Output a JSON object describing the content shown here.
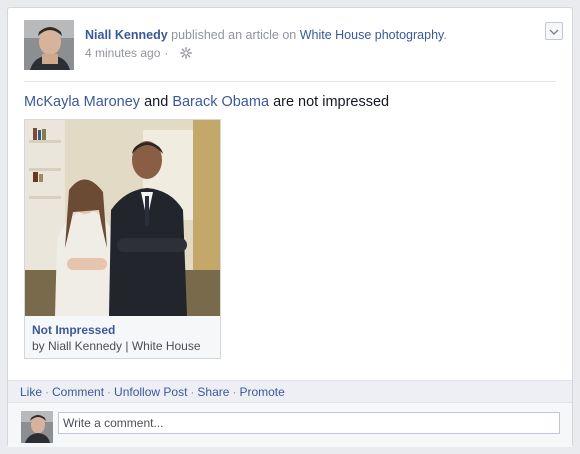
{
  "story": {
    "actor": "Niall Kennedy",
    "verb": "published an article on",
    "target": "White House photography",
    "period": ".",
    "timestamp": "4 minutes ago",
    "meta_sep": "·",
    "privacy_icon": "gear-icon",
    "options_icon": "chevron-down-icon"
  },
  "message": {
    "person1": "McKayla Maroney",
    "and": "and",
    "person2": "Barack Obama",
    "rest": "are not impressed"
  },
  "attachment": {
    "title": "Not Impressed",
    "byline": "by Niall Kennedy | White House"
  },
  "actions": {
    "like": "Like",
    "comment": "Comment",
    "unfollow": "Unfollow Post",
    "share": "Share",
    "promote": "Promote",
    "separator": "·"
  },
  "composer": {
    "placeholder": "Write a comment..."
  },
  "colors": {
    "link": "#3b5998",
    "muted": "#90949c",
    "action_bar_bg": "#edeff4"
  }
}
